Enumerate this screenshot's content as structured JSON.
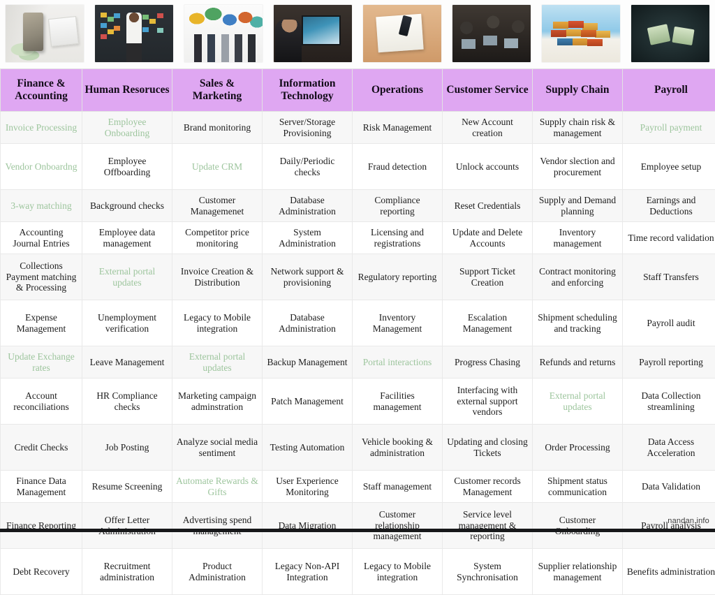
{
  "page": {
    "watermark": "nandan.info"
  },
  "images": [
    {
      "name": "finance-accounting-photo",
      "alt": "Calculator, notepad, pen and cash on a desk"
    },
    {
      "name": "human-resources-photo",
      "alt": "Woman presenting in front of a wall of sticky notes"
    },
    {
      "name": "sales-marketing-photo",
      "alt": "People holding colourful speech bubble signs"
    },
    {
      "name": "information-technology-photo",
      "alt": "Man working at a desk with monitors and a laptop"
    },
    {
      "name": "operations-photo",
      "alt": "Hands working with papers, phone and stationery on a desk"
    },
    {
      "name": "customer-service-photo",
      "alt": "Team working together on laptops"
    },
    {
      "name": "supply-chain-photo",
      "alt": "Stack of shipping containers against a blue sky"
    },
    {
      "name": "payroll-photo",
      "alt": "Hands counting cash banknotes"
    }
  ],
  "table": {
    "columns": [
      "Finance & Accounting",
      "Human Resoruces",
      "Sales & Marketing",
      "Information Technology",
      "Operations",
      "Customer Service",
      "Supply Chain",
      "Payroll"
    ],
    "rows": [
      [
        {
          "text": "Invoice Processing",
          "green": true
        },
        {
          "text": "Employee Onboarding",
          "green": true
        },
        {
          "text": "Brand monitoring",
          "green": false
        },
        {
          "text": "Server/Storage Provisioning",
          "green": false
        },
        {
          "text": "Risk Management",
          "green": false
        },
        {
          "text": "New Account creation",
          "green": false
        },
        {
          "text": "Supply chain risk & management",
          "green": false
        },
        {
          "text": "Payroll payment",
          "green": true
        }
      ],
      [
        {
          "text": "Vendor Onboardng",
          "green": true
        },
        {
          "text": "Employee Offboarding",
          "green": false
        },
        {
          "text": "Update CRM",
          "green": true
        },
        {
          "text": "Daily/Periodic checks",
          "green": false
        },
        {
          "text": "Fraud detection",
          "green": false
        },
        {
          "text": "Unlock accounts",
          "green": false
        },
        {
          "text": "Vendor slection and procurement",
          "green": false
        },
        {
          "text": "Employee setup",
          "green": false
        }
      ],
      [
        {
          "text": "3-way matching",
          "green": true
        },
        {
          "text": "Background checks",
          "green": false
        },
        {
          "text": "Customer Managemenet",
          "green": false
        },
        {
          "text": "Database Administration",
          "green": false
        },
        {
          "text": "Compliance reporting",
          "green": false
        },
        {
          "text": "Reset Credentials",
          "green": false
        },
        {
          "text": "Supply and Demand planning",
          "green": false
        },
        {
          "text": "Earnings and Deductions",
          "green": false
        }
      ],
      [
        {
          "text": "Accounting Journal Entries",
          "green": false
        },
        {
          "text": "Employee data management",
          "green": false
        },
        {
          "text": "Competitor price monitoring",
          "green": false
        },
        {
          "text": "System Administration",
          "green": false
        },
        {
          "text": "Licensing and registrations",
          "green": false
        },
        {
          "text": "Update and Delete Accounts",
          "green": false
        },
        {
          "text": "Inventory management",
          "green": false
        },
        {
          "text": "Time record validation",
          "green": false
        }
      ],
      [
        {
          "text": "Collections Payment matching & Processing",
          "green": false
        },
        {
          "text": "External portal updates",
          "green": true
        },
        {
          "text": "Invoice Creation & Distribution",
          "green": false
        },
        {
          "text": "Network support & provisioning",
          "green": false
        },
        {
          "text": "Regulatory reporting",
          "green": false
        },
        {
          "text": "Support Ticket Creation",
          "green": false
        },
        {
          "text": "Contract monitoring and enforcing",
          "green": false
        },
        {
          "text": "Staff Transfers",
          "green": false
        }
      ],
      [
        {
          "text": "Expense Management",
          "green": false
        },
        {
          "text": "Unemployment verification",
          "green": false
        },
        {
          "text": "Legacy to Mobile integration",
          "green": false
        },
        {
          "text": "Database Administration",
          "green": false
        },
        {
          "text": "Inventory Management",
          "green": false
        },
        {
          "text": "Escalation Management",
          "green": false
        },
        {
          "text": "Shipment scheduling and tracking",
          "green": false
        },
        {
          "text": "Payroll audit",
          "green": false
        }
      ],
      [
        {
          "text": "Update Exchange rates",
          "green": true
        },
        {
          "text": "Leave Management",
          "green": false
        },
        {
          "text": "External portal updates",
          "green": true
        },
        {
          "text": "Backup Management",
          "green": false
        },
        {
          "text": "Portal interactions",
          "green": true
        },
        {
          "text": "Progress Chasing",
          "green": false
        },
        {
          "text": "Refunds and returns",
          "green": false
        },
        {
          "text": "Payroll reporting",
          "green": false
        }
      ],
      [
        {
          "text": "Account reconciliations",
          "green": false
        },
        {
          "text": "HR Compliance checks",
          "green": false
        },
        {
          "text": "Marketing campaign adminstration",
          "green": false
        },
        {
          "text": "Patch Management",
          "green": false
        },
        {
          "text": "Facilities management",
          "green": false
        },
        {
          "text": "Interfacing with external support vendors",
          "green": false
        },
        {
          "text": "External portal updates",
          "green": true
        },
        {
          "text": "Data Collection streamlining",
          "green": false
        }
      ],
      [
        {
          "text": "Credit Checks",
          "green": false
        },
        {
          "text": "Job Posting",
          "green": false
        },
        {
          "text": "Analyze social media sentiment",
          "green": false
        },
        {
          "text": "Testing Automation",
          "green": false
        },
        {
          "text": "Vehicle booking & administration",
          "green": false
        },
        {
          "text": "Updating and closing Tickets",
          "green": false
        },
        {
          "text": "Order Processing",
          "green": false
        },
        {
          "text": "Data Access Acceleration",
          "green": false
        }
      ],
      [
        {
          "text": "Finance Data Management",
          "green": false
        },
        {
          "text": "Resume Screening",
          "green": false
        },
        {
          "text": "Automate Rewards & Gifts",
          "green": true
        },
        {
          "text": "User Experience Monitoring",
          "green": false
        },
        {
          "text": "Staff management",
          "green": false
        },
        {
          "text": "Customer records Management",
          "green": false
        },
        {
          "text": "Shipment status communication",
          "green": false
        },
        {
          "text": "Data Validation",
          "green": false
        }
      ],
      [
        {
          "text": "Finance Reporting",
          "green": false
        },
        {
          "text": "Offer Letter Administration",
          "green": false
        },
        {
          "text": "Advertising spend management",
          "green": false
        },
        {
          "text": "Data Migration",
          "green": false
        },
        {
          "text": "Customer relationship management",
          "green": false
        },
        {
          "text": "Service level management & reporting",
          "green": false
        },
        {
          "text": "Customer Onboarding",
          "green": false
        },
        {
          "text": "Payroll analysis",
          "green": false
        }
      ],
      [
        {
          "text": "Debt Recovery",
          "green": false
        },
        {
          "text": "Recruitment administration",
          "green": false
        },
        {
          "text": "Product Administration",
          "green": false
        },
        {
          "text": "Legacy Non-API Integration",
          "green": false
        },
        {
          "text": "Legacy to Mobile integration",
          "green": false
        },
        {
          "text": "System Synchronisation",
          "green": false
        },
        {
          "text": "Supplier relationship management",
          "green": false
        },
        {
          "text": "Benefits administration",
          "green": false
        }
      ]
    ]
  }
}
